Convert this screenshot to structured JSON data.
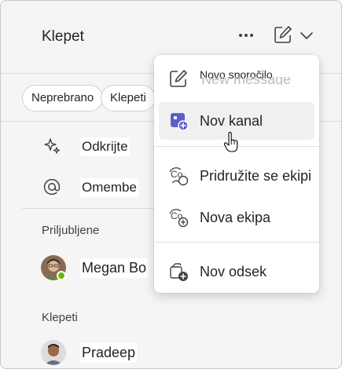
{
  "header": {
    "title": "Klepet",
    "more_icon": "more-horizontal-icon",
    "compose_icon": "compose-icon",
    "chevron_icon": "chevron-down-icon"
  },
  "filters": {
    "chips": [
      "Neprebrano",
      "Klepeti"
    ]
  },
  "nav": {
    "items": [
      {
        "label": "Odkrijte",
        "icon": "sparkle-icon"
      },
      {
        "label": "Omembe",
        "icon": "at-sign-icon"
      }
    ]
  },
  "sections": {
    "favorites_label": "Priljubljene",
    "chats_label": "Klepeti"
  },
  "people": {
    "favorite": {
      "name": "Megan Bo",
      "status": "available",
      "status_color": "#6bb700"
    },
    "chat": {
      "name": "Pradeep"
    }
  },
  "menu": {
    "items": [
      {
        "label": "Novo sporočilo",
        "icon": "compose-icon",
        "ghost": "New message"
      },
      {
        "label": "Nov kanal",
        "icon": "new-channel-icon",
        "hovered": true
      },
      {
        "label": "Pridružite se ekipi",
        "icon": "join-team-icon"
      },
      {
        "label": "Nova ekipa",
        "icon": "new-team-icon"
      },
      {
        "label": "Nov odsek",
        "icon": "new-section-icon"
      }
    ]
  },
  "colors": {
    "accent": "#5b5fc7",
    "panel_bg": "#f5f5f5",
    "menu_bg": "#ffffff"
  }
}
